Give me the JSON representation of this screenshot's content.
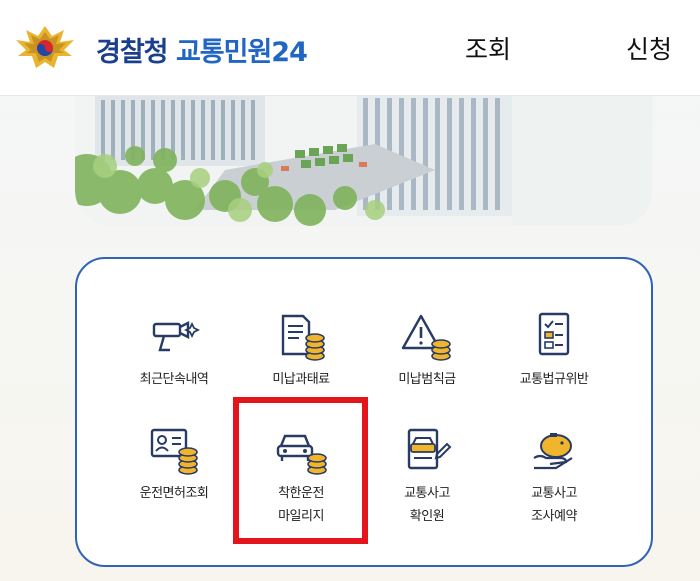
{
  "header": {
    "logo_part1": "경찰청",
    "logo_part2": "교통민원24",
    "nav": {
      "search_label": "조회",
      "apply_label": "신청"
    }
  },
  "services": [
    {
      "id": "recent-enforcement",
      "label1": "최근단속내역",
      "label2": "",
      "icon": "camera-icon"
    },
    {
      "id": "unpaid-fine",
      "label1": "미납과태료",
      "label2": "",
      "icon": "document-coins-icon"
    },
    {
      "id": "unpaid-penalty",
      "label1": "미납범칙금",
      "label2": "",
      "icon": "warning-coins-icon"
    },
    {
      "id": "traffic-violation",
      "label1": "교통법규위반",
      "label2": "",
      "icon": "checklist-icon"
    },
    {
      "id": "license-lookup",
      "label1": "운전면허조회",
      "label2": "",
      "icon": "id-card-coins-icon"
    },
    {
      "id": "safe-driving-mileage",
      "label1": "착한운전",
      "label2": "마일리지",
      "icon": "car-coins-icon"
    },
    {
      "id": "accident-certificate",
      "label1": "교통사고",
      "label2": "확인원",
      "icon": "car-document-icon"
    },
    {
      "id": "accident-reservation",
      "label1": "교통사고",
      "label2": "조사예약",
      "icon": "piggy-bank-icon"
    }
  ],
  "colors": {
    "brand_navy": "#1b3f8c",
    "brand_blue": "#2166c4",
    "panel_border": "#2f63b8",
    "icon_navy": "#283b63",
    "coin_gold": "#f0b52d",
    "highlight_red": "#e3141b"
  }
}
